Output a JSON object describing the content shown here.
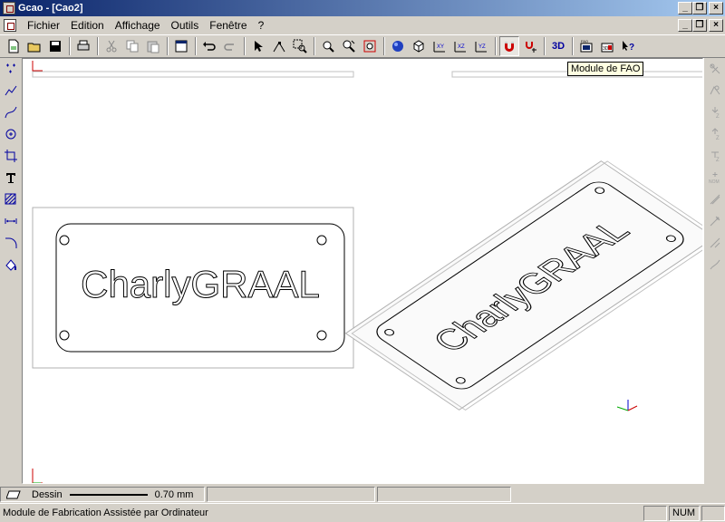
{
  "window": {
    "title": "Gcao - [Cao2]"
  },
  "menu": {
    "items": [
      {
        "label": "Fichier",
        "accel": "F"
      },
      {
        "label": "Edition",
        "accel": "E"
      },
      {
        "label": "Affichage",
        "accel": "A"
      },
      {
        "label": "Outils",
        "accel": ""
      },
      {
        "label": "Fenêtre",
        "accel": "n"
      },
      {
        "label": "?",
        "accel": "?"
      }
    ]
  },
  "toolbar": {
    "label_3d": "3D",
    "fao_label": "FAO",
    "fao3d_label": "3D"
  },
  "tooltip": {
    "text": "Module de FAO"
  },
  "canvas": {
    "plate_text": "CharlyGRAAL"
  },
  "status": {
    "mode_label": "Dessin",
    "line_width": "0.70 mm",
    "message": "Module de Fabrication Assistée par Ordinateur",
    "num_indicator": "NUM"
  },
  "colors": {
    "accent_title": "#0a246a",
    "axis_x": "#cc0000",
    "axis_y": "#00aa00",
    "axis_z": "#0000cc"
  }
}
